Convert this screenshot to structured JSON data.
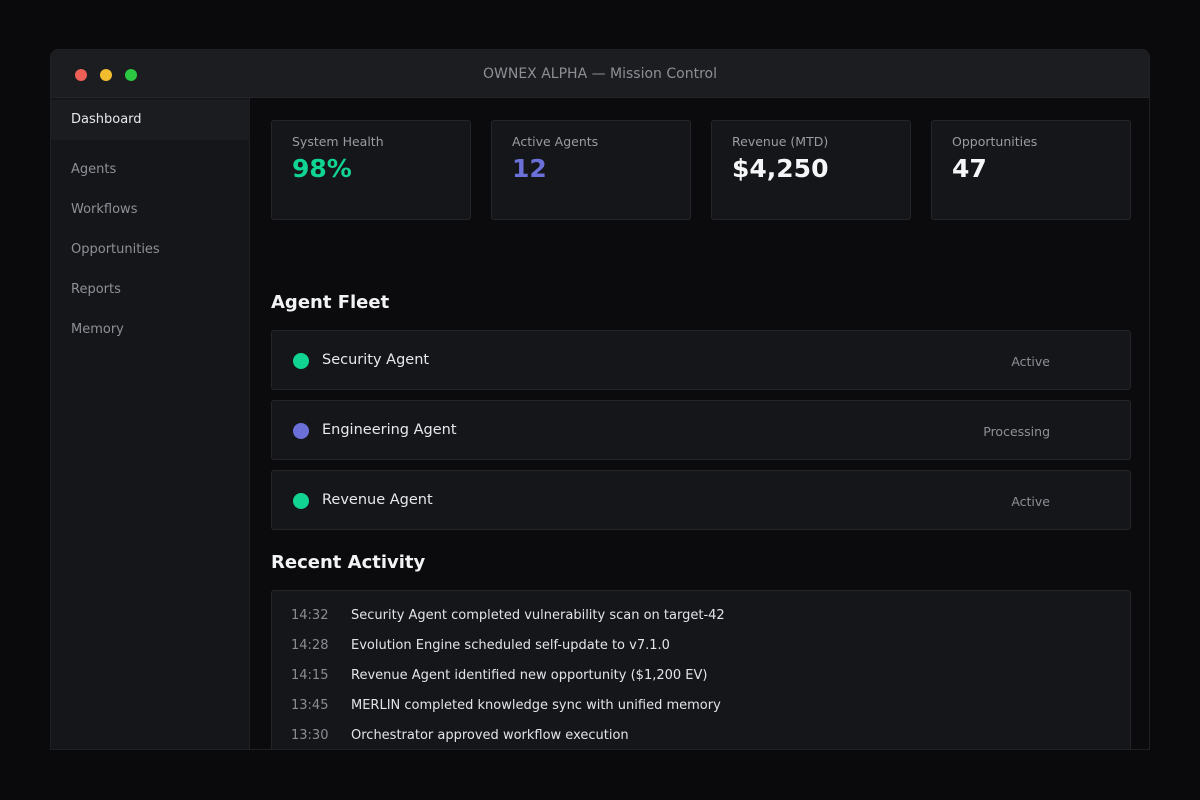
{
  "window": {
    "title": "OWNEX ALPHA — Mission Control"
  },
  "sidebar": {
    "items": [
      {
        "label": "Dashboard",
        "active": true
      },
      {
        "label": "Agents",
        "active": false
      },
      {
        "label": "Workflows",
        "active": false
      },
      {
        "label": "Opportunities",
        "active": false
      },
      {
        "label": "Reports",
        "active": false
      },
      {
        "label": "Memory",
        "active": false
      }
    ]
  },
  "stats": [
    {
      "label": "System Health",
      "value": "98%",
      "color": "#10d491"
    },
    {
      "label": "Active Agents",
      "value": "12",
      "color": "#6b6fd8"
    },
    {
      "label": "Revenue (MTD)",
      "value": "$4,250",
      "color": "#f5f6f8"
    },
    {
      "label": "Opportunities",
      "value": "47",
      "color": "#f5f6f8"
    }
  ],
  "agent_fleet": {
    "title": "Agent Fleet",
    "agents": [
      {
        "name": "Security Agent",
        "status": "Active",
        "status_color": "#10d491"
      },
      {
        "name": "Engineering Agent",
        "status": "Processing",
        "status_color": "#6b6fd8"
      },
      {
        "name": "Revenue Agent",
        "status": "Active",
        "status_color": "#10d491"
      }
    ]
  },
  "recent_activity": {
    "title": "Recent Activity",
    "entries": [
      {
        "time": "14:32",
        "text": "Security Agent completed vulnerability scan on target-42"
      },
      {
        "time": "14:28",
        "text": "Evolution Engine scheduled self-update to v7.1.0"
      },
      {
        "time": "14:15",
        "text": "Revenue Agent identified new opportunity ($1,200 EV)"
      },
      {
        "time": "13:45",
        "text": "MERLIN completed knowledge sync with unified memory"
      },
      {
        "time": "13:30",
        "text": "Orchestrator approved workflow execution"
      }
    ]
  }
}
